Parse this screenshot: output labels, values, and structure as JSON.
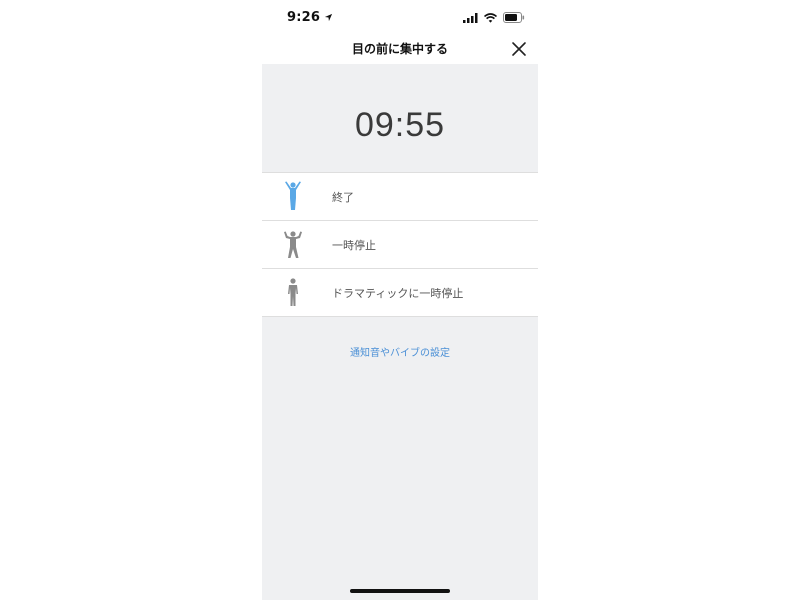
{
  "status_bar": {
    "time": "9:26",
    "icons": [
      "location-arrow-icon",
      "signal-icon",
      "wifi-icon",
      "battery-icon"
    ]
  },
  "nav": {
    "title": "目の前に集中する",
    "close_icon": "close-icon"
  },
  "timer": {
    "value": "09:55"
  },
  "actions": [
    {
      "label": "終了",
      "icon": "person-arms-up-icon",
      "color": "#5aa8e6"
    },
    {
      "label": "一時停止",
      "icon": "person-flexing-icon",
      "color": "#8a8a8a"
    },
    {
      "label": "ドラマティックに一時停止",
      "icon": "person-standing-icon",
      "color": "#8a8a8a"
    }
  ],
  "settings_link": {
    "label": "通知音やバイブの設定"
  },
  "colors": {
    "accent": "#4a8fd6",
    "background": "#eff0f2"
  }
}
